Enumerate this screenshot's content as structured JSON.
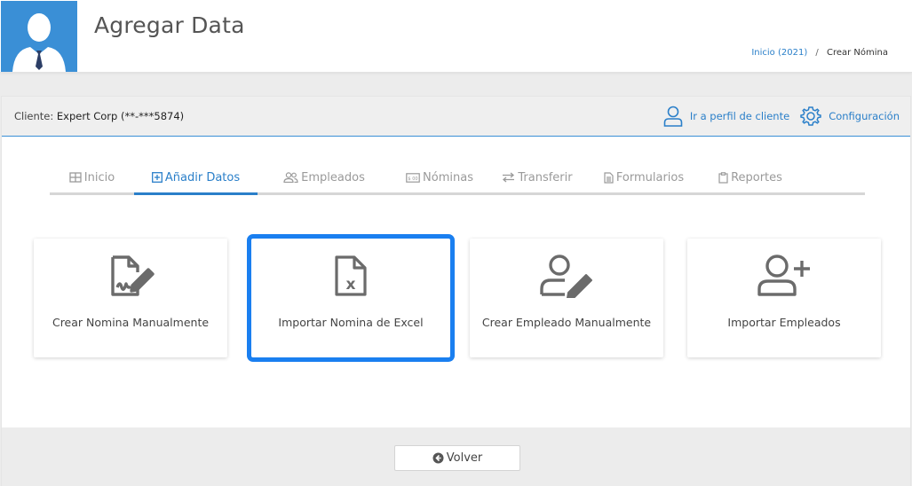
{
  "header": {
    "title": "Agregar Data",
    "breadcrumb": {
      "link": "Inicio (2021)",
      "separator": "/",
      "current": "Crear Nómina"
    }
  },
  "client_bar": {
    "label": "Cliente:",
    "client_name": "Expert Corp (**-***5874)",
    "profile_link": "Ir a perfil de cliente",
    "config_link": "Configuración"
  },
  "tabs": [
    {
      "label": "Inicio",
      "icon": "grid-icon",
      "active": false
    },
    {
      "label": "Añadir Datos",
      "icon": "plus-square-icon",
      "active": true
    },
    {
      "label": "Empleados",
      "icon": "users-icon",
      "active": false
    },
    {
      "label": "Nóminas",
      "icon": "money-icon",
      "active": false
    },
    {
      "label": "Transferir",
      "icon": "exchange-icon",
      "active": false
    },
    {
      "label": "Formularios",
      "icon": "file-text-icon",
      "active": false
    },
    {
      "label": "Reportes",
      "icon": "clipboard-icon",
      "active": false
    }
  ],
  "cards": [
    {
      "label": "Crear Nomina Manualmente",
      "icon": "file-signature-icon",
      "selected": false
    },
    {
      "label": "Importar Nomina de Excel",
      "icon": "file-excel-icon",
      "selected": true
    },
    {
      "label": "Crear Empleado Manualmente",
      "icon": "user-edit-icon",
      "selected": false
    },
    {
      "label": "Importar Empleados",
      "icon": "user-plus-icon",
      "selected": false
    }
  ],
  "footer": {
    "back_label": "Volver",
    "back_icon": "arrow-circle-left-icon"
  },
  "colors": {
    "accent": "#2a7fc9",
    "avatar_bg": "#3a8fd6",
    "highlight": "#1a7ff0",
    "icon_gray": "#6b6b6b"
  }
}
